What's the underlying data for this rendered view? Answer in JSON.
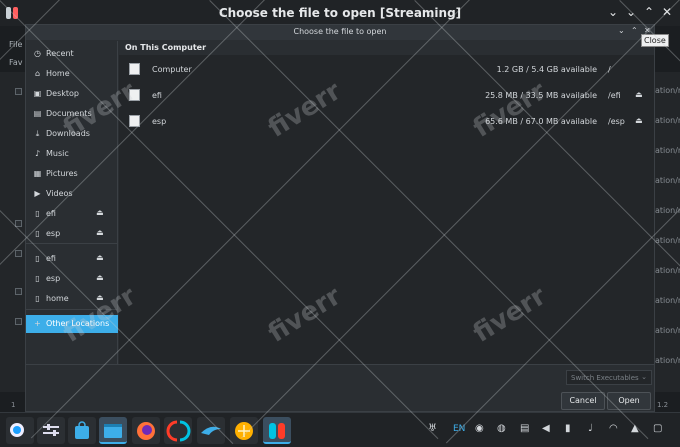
{
  "window": {
    "title": "Choose the file to open [Streaming]"
  },
  "background_app": {
    "menu_file": "File",
    "menu_fav": "Fav",
    "right_texts": [
      "ation/ru",
      "ation/re",
      "ation/ri",
      "ation/re",
      "ation/re",
      "ation/ru",
      "ation/ru",
      "ation/ru",
      "ation/re",
      "ation/ru"
    ],
    "footer_left": "1",
    "footer_right": "1.2"
  },
  "dialog": {
    "title": "Choose the file to open",
    "close_tooltip": "Close",
    "sidebar": [
      {
        "icon": "clock-icon",
        "glyph": "◷",
        "label": "Recent"
      },
      {
        "icon": "home-icon",
        "glyph": "⌂",
        "label": "Home"
      },
      {
        "icon": "desktop-icon",
        "glyph": "▣",
        "label": "Desktop"
      },
      {
        "icon": "documents-icon",
        "glyph": "▤",
        "label": "Documents"
      },
      {
        "icon": "downloads-icon",
        "glyph": "⤓",
        "label": "Downloads"
      },
      {
        "icon": "music-icon",
        "glyph": "♪",
        "label": "Music"
      },
      {
        "icon": "pictures-icon",
        "glyph": "▦",
        "label": "Pictures"
      },
      {
        "icon": "videos-icon",
        "glyph": "▶",
        "label": "Videos"
      },
      {
        "icon": "drive-icon",
        "glyph": "▯",
        "label": "efi",
        "eject": true
      },
      {
        "icon": "drive-icon",
        "glyph": "▯",
        "label": "esp",
        "eject": true
      },
      {
        "icon": "drive-icon",
        "glyph": "▯",
        "label": "efi",
        "eject": true
      },
      {
        "icon": "drive-icon",
        "glyph": "▯",
        "label": "esp",
        "eject": true
      },
      {
        "icon": "drive-icon",
        "glyph": "▯",
        "label": "home",
        "eject": true
      },
      {
        "icon": "plus-icon",
        "glyph": "+",
        "label": "Other Locations"
      }
    ],
    "main_header": "On This Computer",
    "locations": [
      {
        "name": "Computer",
        "size": "1.2 GB / 5.4 GB available",
        "mount": "/",
        "eject": false
      },
      {
        "name": "efi",
        "size": "25.8 MB / 33.5 MB available",
        "mount": "/efi",
        "eject": true
      },
      {
        "name": "esp",
        "size": "65.6 MB / 67.0 MB available",
        "mount": "/esp",
        "eject": true
      }
    ],
    "filter": "Switch Executables",
    "cancel": "Cancel",
    "open": "Open"
  },
  "taskbar": {
    "language": "EN"
  },
  "watermark": "fiverr",
  "colors": {
    "accent": "#3daee9",
    "window_bg": "#2a2e32",
    "view_bg": "#232629"
  }
}
